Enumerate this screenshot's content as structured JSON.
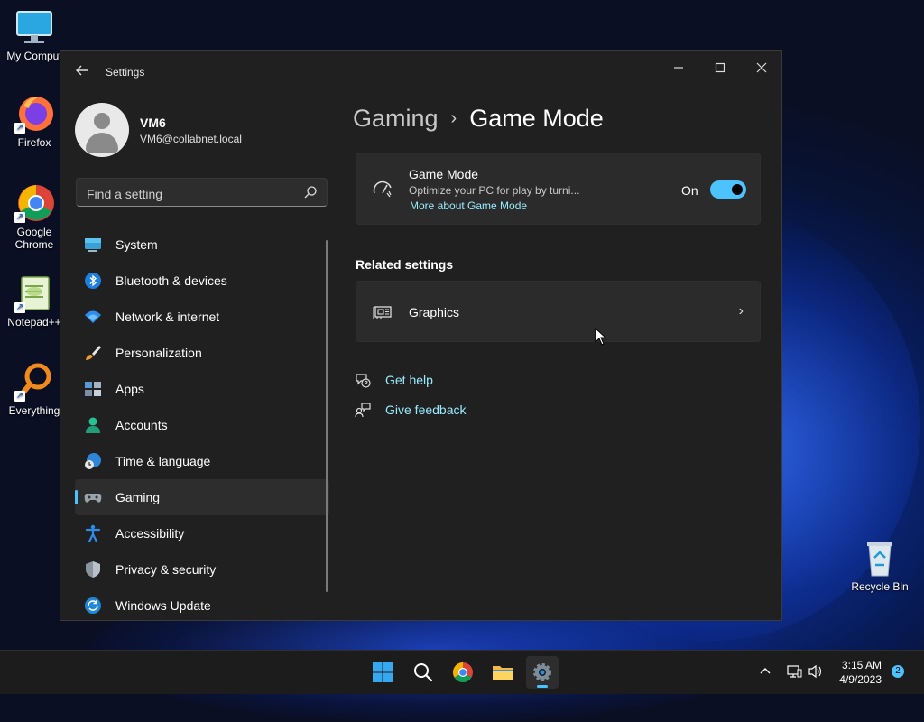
{
  "desktop": {
    "icons": [
      {
        "label": "My Comput"
      },
      {
        "label": "Firefox"
      },
      {
        "label": "Google Chrome"
      },
      {
        "label": "Notepad++"
      },
      {
        "label": "Everything"
      },
      {
        "label": "Recycle Bin"
      }
    ]
  },
  "window": {
    "title": "Settings",
    "controls": {
      "minimize": "—",
      "maximize": "☐",
      "close": "✕"
    }
  },
  "profile": {
    "name": "VM6",
    "email": "VM6@collabnet.local"
  },
  "search": {
    "placeholder": "Find a setting"
  },
  "nav": {
    "items": [
      {
        "label": "System",
        "icon": "monitor-icon"
      },
      {
        "label": "Bluetooth & devices",
        "icon": "bluetooth-icon"
      },
      {
        "label": "Network & internet",
        "icon": "wifi-icon"
      },
      {
        "label": "Personalization",
        "icon": "brush-icon"
      },
      {
        "label": "Apps",
        "icon": "apps-icon"
      },
      {
        "label": "Accounts",
        "icon": "person-icon"
      },
      {
        "label": "Time & language",
        "icon": "globe-clock-icon"
      },
      {
        "label": "Gaming",
        "icon": "gamepad-icon",
        "active": true
      },
      {
        "label": "Accessibility",
        "icon": "accessibility-icon"
      },
      {
        "label": "Privacy & security",
        "icon": "shield-icon"
      },
      {
        "label": "Windows Update",
        "icon": "update-icon"
      }
    ]
  },
  "content": {
    "breadcrumb": {
      "parent": "Gaming",
      "separator": "›",
      "current": "Game Mode"
    },
    "game_mode": {
      "title": "Game Mode",
      "description": "Optimize your PC for play by turni...",
      "link": "More about Game Mode",
      "state": "On",
      "enabled": true
    },
    "related_heading": "Related settings",
    "graphics": {
      "label": "Graphics",
      "chevron": "›"
    },
    "help": {
      "get_help": "Get help",
      "give_feedback": "Give feedback"
    }
  },
  "taskbar": {
    "time": "3:15 AM",
    "date": "4/9/2023",
    "notifications": "2",
    "tray_chevron": "^"
  },
  "colors": {
    "accent": "#4cc2ff",
    "link": "#99ebff",
    "window_bg": "#202020",
    "card_bg": "#2b2b2b"
  }
}
